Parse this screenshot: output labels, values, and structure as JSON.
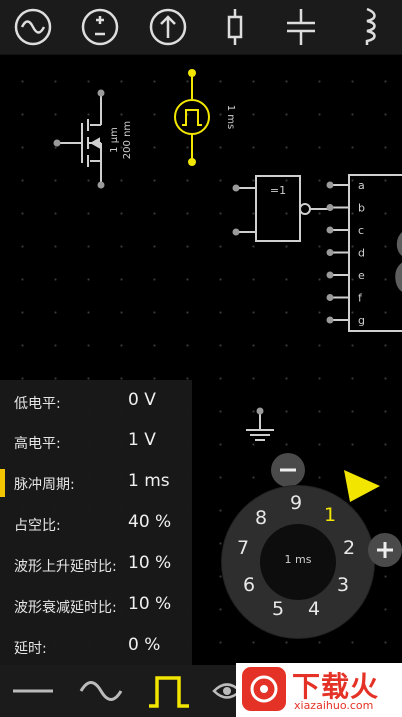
{
  "toolbar": {
    "icons": [
      "ac-source-icon",
      "dc-source-icon",
      "voltage-arrow-icon",
      "resistor-icon",
      "capacitor-icon",
      "inductor-icon"
    ]
  },
  "circuit": {
    "transistor_w": "1 µm",
    "transistor_l": "200 nm",
    "pulse_period": "1 ms",
    "xor_label": "=1",
    "segment_pins": [
      "a",
      "b",
      "c",
      "d",
      "e",
      "f",
      "g"
    ],
    "segment_digit": "8",
    "accent": "#f2e600"
  },
  "params": [
    {
      "label": "低电平:",
      "value": "0 V"
    },
    {
      "label": "高电平:",
      "value": "1 V"
    },
    {
      "label": "脉冲周期:",
      "value": "1 ms"
    },
    {
      "label": "占空比:",
      "value": "40 %"
    },
    {
      "label": "波形上升延时比:",
      "value": "10 %"
    },
    {
      "label": "波形衰减延时比:",
      "value": "10 %"
    },
    {
      "label": "延时:",
      "value": "0 %"
    }
  ],
  "dial": {
    "center_value": "1 ms",
    "numbers": [
      "1",
      "2",
      "3",
      "4",
      "5",
      "6",
      "7",
      "8",
      "9"
    ]
  },
  "bottom": {
    "icons": [
      "dc-line-icon",
      "sine-wave-icon",
      "pulse-wave-icon",
      "eye-icon"
    ]
  },
  "watermark": {
    "name": "下载火",
    "url": "xiazaihuo.com"
  }
}
